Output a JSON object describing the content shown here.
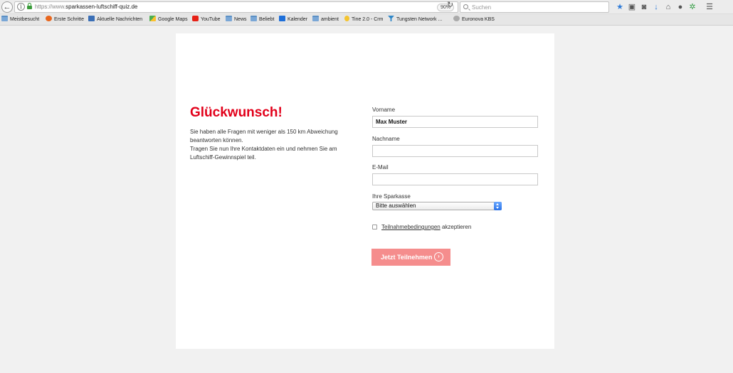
{
  "browser": {
    "url_prefix": "https://www.",
    "url_domain": "sparkassen-luftschiff-quiz.de",
    "zoom": "90%",
    "search_placeholder": "Suchen"
  },
  "bookmarks": [
    {
      "label": "Meistbesucht",
      "icon": "folder"
    },
    {
      "label": "Erste Schritte",
      "icon": "firefox"
    },
    {
      "label": "Aktuelle Nachrichten",
      "icon": "news"
    },
    {
      "label": "Google Maps",
      "icon": "maps"
    },
    {
      "label": "YouTube",
      "icon": "youtube"
    },
    {
      "label": "News",
      "icon": "folder"
    },
    {
      "label": "Beliebt",
      "icon": "folder"
    },
    {
      "label": "Kalender",
      "icon": "calendar"
    },
    {
      "label": "ambient",
      "icon": "folder"
    },
    {
      "label": "Tine 2.0 - Crm",
      "icon": "tine"
    },
    {
      "label": "Tungsten Network ...",
      "icon": "tungsten"
    },
    {
      "label": "Euronova KBS",
      "icon": "globe"
    }
  ],
  "page": {
    "headline": "Glückwunsch!",
    "intro_line1": "Sie haben alle Fragen mit weniger als 150 km Abweichung beantworten können.",
    "intro_line2": "Tragen Sie nun Ihre Kontaktdaten ein und nehmen Sie am Luftschiff-Gewinnspiel teil."
  },
  "form": {
    "firstname_label": "Vorname",
    "firstname_value": "Max Muster",
    "lastname_label": "Nachname",
    "lastname_value": "",
    "email_label": "E-Mail",
    "email_value": "",
    "sparkasse_label": "Ihre Sparkasse",
    "sparkasse_selected": "Bitte auswählen",
    "terms_link": "Teilnahmebedingungen",
    "terms_suffix": " akzeptieren",
    "submit_label": "Jetzt Teilnehmen",
    "accent_color": "#e2001a",
    "button_color": "#f58d8d"
  }
}
